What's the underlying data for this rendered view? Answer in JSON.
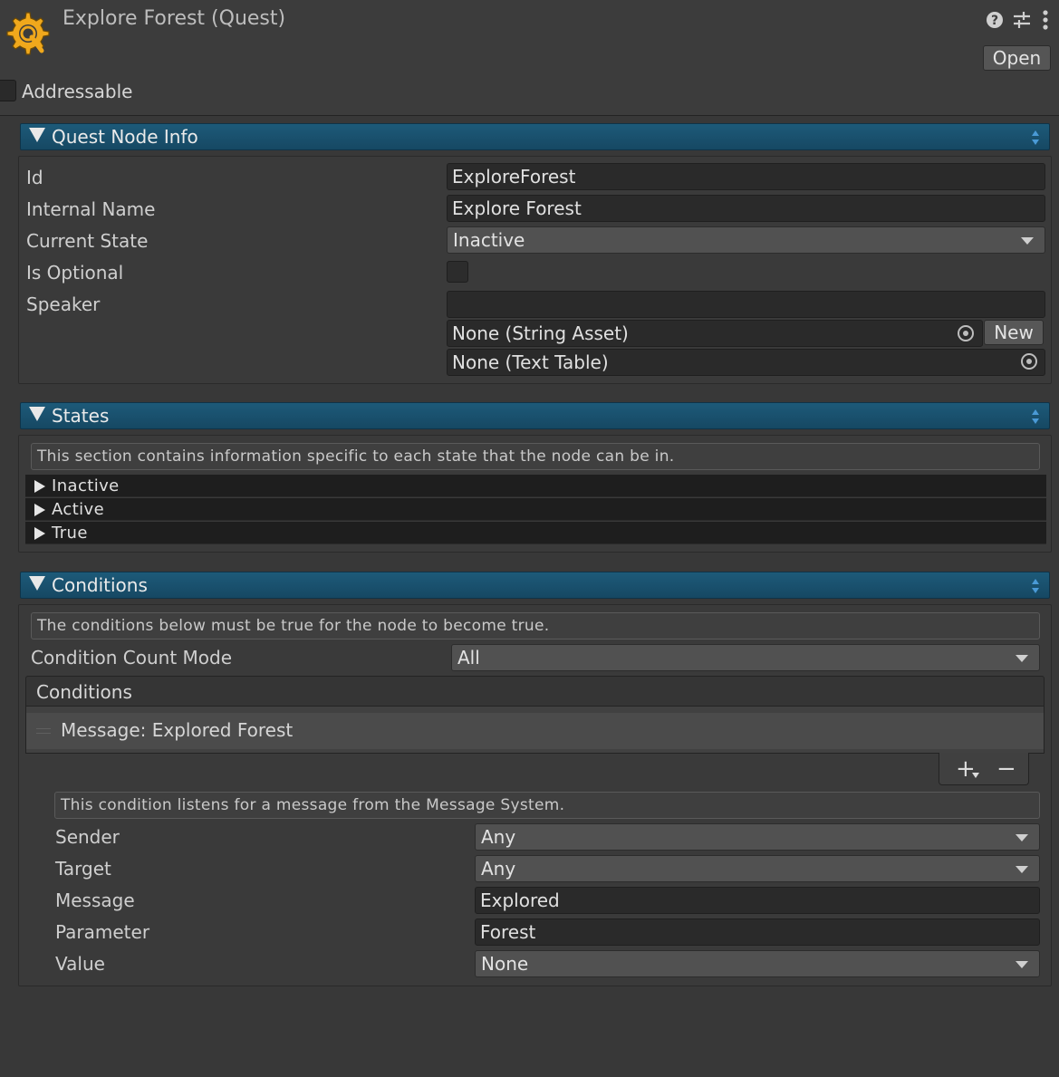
{
  "header": {
    "title": "Explore Forest (Quest)",
    "open_label": "Open",
    "addressable_label": "Addressable",
    "icons": [
      "quest-gear-icon",
      "help-icon",
      "preset-sliders-icon",
      "more-menu-icon"
    ]
  },
  "quest_node_info": {
    "title": "Quest Node Info",
    "fields": {
      "id_label": "Id",
      "id_value": "ExploreForest",
      "internal_name_label": "Internal Name",
      "internal_name_value": "Explore Forest",
      "current_state_label": "Current State",
      "current_state_value": "Inactive",
      "is_optional_label": "Is Optional",
      "speaker_label": "Speaker",
      "speaker_value": "",
      "string_asset_value": "None (String Asset)",
      "new_label": "New",
      "text_table_value": "None (Text Table)"
    }
  },
  "states": {
    "title": "States",
    "help": "This section contains information specific to each state that the node can be in.",
    "items": [
      "Inactive",
      "Active",
      "True"
    ]
  },
  "conditions": {
    "title": "Conditions",
    "help": "The conditions below must be true for the node to become true.",
    "count_mode_label": "Condition Count Mode",
    "count_mode_value": "All",
    "list_title": "Conditions",
    "list_items": [
      "Message: Explored Forest"
    ],
    "add_label": "+",
    "remove_label": "−",
    "condition_help": "This condition listens for a message from the Message System.",
    "sender_label": "Sender",
    "sender_value": "Any",
    "target_label": "Target",
    "target_value": "Any",
    "message_label": "Message",
    "message_value": "Explored",
    "parameter_label": "Parameter",
    "parameter_value": "Forest",
    "value_label": "Value",
    "value_value": "None"
  },
  "colors": {
    "background": "#383838",
    "section_header": "#1d5a79",
    "accent_gear": "#f0a81c"
  }
}
